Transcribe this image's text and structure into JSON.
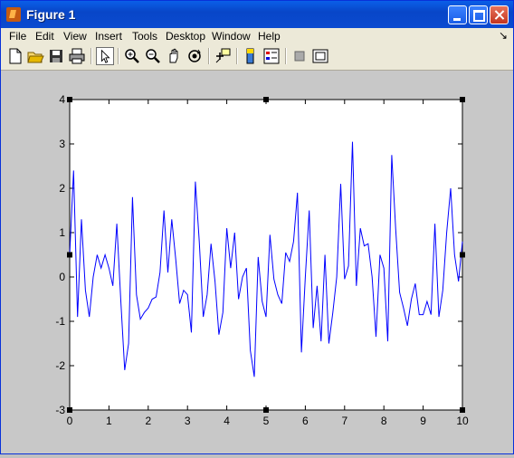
{
  "window": {
    "title": "Figure 1"
  },
  "menu": {
    "items": [
      {
        "label": "File"
      },
      {
        "label": "Edit"
      },
      {
        "label": "View"
      },
      {
        "label": "Insert"
      },
      {
        "label": "Tools"
      },
      {
        "label": "Desktop"
      },
      {
        "label": "Window"
      },
      {
        "label": "Help"
      }
    ],
    "dock_arrow": "↘"
  },
  "toolbar": {
    "buttons": [
      "new-file-icon",
      "open-folder-icon",
      "save-icon",
      "print-icon",
      "select-arrow-icon",
      "zoom-in-icon",
      "zoom-out-icon",
      "pan-hand-icon",
      "rotate-3d-icon",
      "data-cursor-icon",
      "colorbar-icon",
      "legend-icon",
      "hide-plot-tools-icon",
      "show-plot-tools-icon"
    ]
  },
  "colors": {
    "line": "#0000ff",
    "figure_bg": "#c8c8c8",
    "axes_bg": "#ffffff"
  },
  "chart_data": {
    "type": "line",
    "title": "",
    "xlabel": "",
    "ylabel": "",
    "xlim": [
      0,
      10
    ],
    "ylim": [
      -3,
      4
    ],
    "xticks": [
      "0",
      "1",
      "2",
      "3",
      "4",
      "5",
      "6",
      "7",
      "8",
      "9",
      "10"
    ],
    "yticks": [
      "-3",
      "-2",
      "-1",
      "0",
      "1",
      "2",
      "3",
      "4"
    ],
    "grid": false,
    "series": [
      {
        "x": [
          0,
          0.1,
          0.2,
          0.3,
          0.4,
          0.5,
          0.6,
          0.7,
          0.8,
          0.9,
          1.0,
          1.1,
          1.2,
          1.3,
          1.4,
          1.5,
          1.6,
          1.7,
          1.8,
          1.9,
          2.0,
          2.1,
          2.2,
          2.3,
          2.4,
          2.5,
          2.6,
          2.7,
          2.8,
          2.9,
          3.0,
          3.1,
          3.2,
          3.3,
          3.4,
          3.5,
          3.6,
          3.7,
          3.8,
          3.9,
          4.0,
          4.1,
          4.2,
          4.3,
          4.4,
          4.5,
          4.6,
          4.7,
          4.8,
          4.9,
          5.0,
          5.1,
          5.2,
          5.3,
          5.4,
          5.5,
          5.6,
          5.7,
          5.8,
          5.9,
          6.0,
          6.1,
          6.2,
          6.3,
          6.4,
          6.5,
          6.6,
          6.7,
          6.8,
          6.9,
          7.0,
          7.1,
          7.2,
          7.3,
          7.4,
          7.5,
          7.6,
          7.7,
          7.8,
          7.9,
          8.0,
          8.1,
          8.2,
          8.3,
          8.4,
          8.5,
          8.6,
          8.7,
          8.8,
          8.9,
          9.0,
          9.1,
          9.2,
          9.3,
          9.4,
          9.5,
          9.6,
          9.7,
          9.8,
          9.9,
          10.0
        ],
        "y": [
          0.5,
          2.4,
          -0.9,
          1.3,
          -0.3,
          -0.9,
          0.0,
          0.5,
          0.2,
          0.5,
          0.2,
          -0.2,
          1.2,
          -0.5,
          -2.1,
          -1.5,
          1.8,
          -0.4,
          -0.95,
          -0.8,
          -0.7,
          -0.5,
          -0.45,
          0.1,
          1.5,
          0.1,
          1.3,
          0.4,
          -0.6,
          -0.3,
          -0.4,
          -1.25,
          2.15,
          0.8,
          -0.9,
          -0.4,
          0.75,
          -0.1,
          -1.3,
          -0.8,
          1.1,
          0.2,
          1.0,
          -0.5,
          0.0,
          0.2,
          -1.65,
          -2.25,
          0.45,
          -0.55,
          -0.9,
          0.95,
          -0.05,
          -0.4,
          -0.6,
          0.55,
          0.35,
          0.8,
          1.9,
          -1.7,
          0.0,
          1.5,
          -1.15,
          -0.2,
          -1.45,
          0.5,
          -1.5,
          -0.8,
          0.0,
          2.1,
          -0.05,
          0.25,
          3.05,
          -0.2,
          1.1,
          0.7,
          0.75,
          0.0,
          -1.35,
          0.5,
          0.2,
          -1.45,
          2.75,
          1.1,
          -0.35,
          -0.7,
          -1.1,
          -0.5,
          -0.15,
          -0.85,
          -0.85,
          -0.55,
          -0.85,
          1.2,
          -0.9,
          -0.3,
          1.0,
          2.0,
          0.5,
          -0.1,
          0.8
        ]
      }
    ]
  }
}
